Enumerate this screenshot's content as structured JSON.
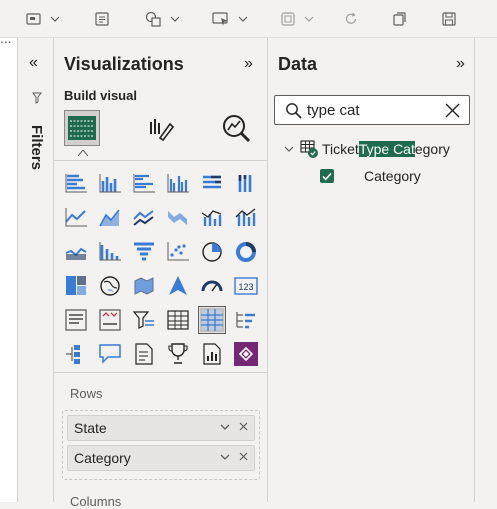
{
  "toolbar": {
    "icons": [
      "view-icon",
      "format-icon",
      "shapes-icon",
      "present-icon",
      "copy-layout-icon",
      "refresh-icon",
      "duplicate-icon",
      "save-icon"
    ]
  },
  "left_edge": {
    "dots": "..."
  },
  "filters_pane": {
    "collapse_glyph": "«",
    "title": "Filters"
  },
  "visualizations_pane": {
    "title": "Visualizations",
    "expand_glyph": "»",
    "build_visual_label": "Build visual",
    "rows_label": "Rows",
    "rows_fields": [
      "State",
      "Category"
    ],
    "columns_label": "Columns"
  },
  "data_pane": {
    "title": "Data",
    "expand_glyph": "»",
    "search_value": "type cat",
    "table": {
      "prefix": "Ticket ",
      "highlight": "Type Cat",
      "suffix": "egory"
    },
    "field": {
      "label": "Category",
      "checked": true
    }
  },
  "colors": {
    "accent_green": "#1f6b4f",
    "viz_blue": "#3a7bd5",
    "pane_bg": "#f3f2f1"
  }
}
